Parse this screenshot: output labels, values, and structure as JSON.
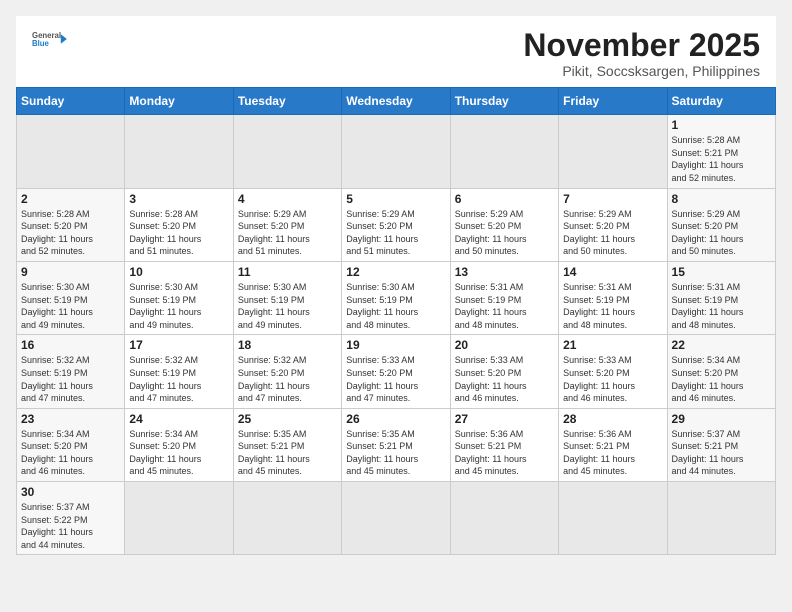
{
  "header": {
    "logo_line1": "General",
    "logo_line2": "Blue",
    "month_title": "November 2025",
    "location": "Pikit, Soccsksargen, Philippines"
  },
  "weekdays": [
    "Sunday",
    "Monday",
    "Tuesday",
    "Wednesday",
    "Thursday",
    "Friday",
    "Saturday"
  ],
  "weeks": [
    [
      {
        "day": "",
        "info": ""
      },
      {
        "day": "",
        "info": ""
      },
      {
        "day": "",
        "info": ""
      },
      {
        "day": "",
        "info": ""
      },
      {
        "day": "",
        "info": ""
      },
      {
        "day": "",
        "info": ""
      },
      {
        "day": "1",
        "info": "Sunrise: 5:28 AM\nSunset: 5:21 PM\nDaylight: 11 hours\nand 52 minutes."
      }
    ],
    [
      {
        "day": "2",
        "info": "Sunrise: 5:28 AM\nSunset: 5:20 PM\nDaylight: 11 hours\nand 52 minutes."
      },
      {
        "day": "3",
        "info": "Sunrise: 5:28 AM\nSunset: 5:20 PM\nDaylight: 11 hours\nand 51 minutes."
      },
      {
        "day": "4",
        "info": "Sunrise: 5:29 AM\nSunset: 5:20 PM\nDaylight: 11 hours\nand 51 minutes."
      },
      {
        "day": "5",
        "info": "Sunrise: 5:29 AM\nSunset: 5:20 PM\nDaylight: 11 hours\nand 51 minutes."
      },
      {
        "day": "6",
        "info": "Sunrise: 5:29 AM\nSunset: 5:20 PM\nDaylight: 11 hours\nand 50 minutes."
      },
      {
        "day": "7",
        "info": "Sunrise: 5:29 AM\nSunset: 5:20 PM\nDaylight: 11 hours\nand 50 minutes."
      },
      {
        "day": "8",
        "info": "Sunrise: 5:29 AM\nSunset: 5:20 PM\nDaylight: 11 hours\nand 50 minutes."
      }
    ],
    [
      {
        "day": "9",
        "info": "Sunrise: 5:30 AM\nSunset: 5:19 PM\nDaylight: 11 hours\nand 49 minutes."
      },
      {
        "day": "10",
        "info": "Sunrise: 5:30 AM\nSunset: 5:19 PM\nDaylight: 11 hours\nand 49 minutes."
      },
      {
        "day": "11",
        "info": "Sunrise: 5:30 AM\nSunset: 5:19 PM\nDaylight: 11 hours\nand 49 minutes."
      },
      {
        "day": "12",
        "info": "Sunrise: 5:30 AM\nSunset: 5:19 PM\nDaylight: 11 hours\nand 48 minutes."
      },
      {
        "day": "13",
        "info": "Sunrise: 5:31 AM\nSunset: 5:19 PM\nDaylight: 11 hours\nand 48 minutes."
      },
      {
        "day": "14",
        "info": "Sunrise: 5:31 AM\nSunset: 5:19 PM\nDaylight: 11 hours\nand 48 minutes."
      },
      {
        "day": "15",
        "info": "Sunrise: 5:31 AM\nSunset: 5:19 PM\nDaylight: 11 hours\nand 48 minutes."
      }
    ],
    [
      {
        "day": "16",
        "info": "Sunrise: 5:32 AM\nSunset: 5:19 PM\nDaylight: 11 hours\nand 47 minutes."
      },
      {
        "day": "17",
        "info": "Sunrise: 5:32 AM\nSunset: 5:19 PM\nDaylight: 11 hours\nand 47 minutes."
      },
      {
        "day": "18",
        "info": "Sunrise: 5:32 AM\nSunset: 5:20 PM\nDaylight: 11 hours\nand 47 minutes."
      },
      {
        "day": "19",
        "info": "Sunrise: 5:33 AM\nSunset: 5:20 PM\nDaylight: 11 hours\nand 47 minutes."
      },
      {
        "day": "20",
        "info": "Sunrise: 5:33 AM\nSunset: 5:20 PM\nDaylight: 11 hours\nand 46 minutes."
      },
      {
        "day": "21",
        "info": "Sunrise: 5:33 AM\nSunset: 5:20 PM\nDaylight: 11 hours\nand 46 minutes."
      },
      {
        "day": "22",
        "info": "Sunrise: 5:34 AM\nSunset: 5:20 PM\nDaylight: 11 hours\nand 46 minutes."
      }
    ],
    [
      {
        "day": "23",
        "info": "Sunrise: 5:34 AM\nSunset: 5:20 PM\nDaylight: 11 hours\nand 46 minutes."
      },
      {
        "day": "24",
        "info": "Sunrise: 5:34 AM\nSunset: 5:20 PM\nDaylight: 11 hours\nand 45 minutes."
      },
      {
        "day": "25",
        "info": "Sunrise: 5:35 AM\nSunset: 5:21 PM\nDaylight: 11 hours\nand 45 minutes."
      },
      {
        "day": "26",
        "info": "Sunrise: 5:35 AM\nSunset: 5:21 PM\nDaylight: 11 hours\nand 45 minutes."
      },
      {
        "day": "27",
        "info": "Sunrise: 5:36 AM\nSunset: 5:21 PM\nDaylight: 11 hours\nand 45 minutes."
      },
      {
        "day": "28",
        "info": "Sunrise: 5:36 AM\nSunset: 5:21 PM\nDaylight: 11 hours\nand 45 minutes."
      },
      {
        "day": "29",
        "info": "Sunrise: 5:37 AM\nSunset: 5:21 PM\nDaylight: 11 hours\nand 44 minutes."
      }
    ],
    [
      {
        "day": "30",
        "info": "Sunrise: 5:37 AM\nSunset: 5:22 PM\nDaylight: 11 hours\nand 44 minutes."
      },
      {
        "day": "",
        "info": ""
      },
      {
        "day": "",
        "info": ""
      },
      {
        "day": "",
        "info": ""
      },
      {
        "day": "",
        "info": ""
      },
      {
        "day": "",
        "info": ""
      },
      {
        "day": "",
        "info": ""
      }
    ]
  ]
}
